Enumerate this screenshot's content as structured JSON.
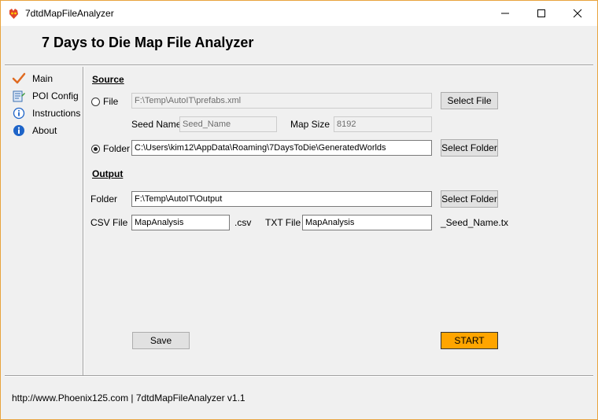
{
  "window": {
    "title": "7dtdMapFileAnalyzer",
    "header": "7 Days to Die Map File Analyzer"
  },
  "sidebar": {
    "items": [
      {
        "label": "Main",
        "icon": "checkmark-icon"
      },
      {
        "label": "POI Config",
        "icon": "config-icon"
      },
      {
        "label": "Instructions",
        "icon": "info-outline-icon"
      },
      {
        "label": "About",
        "icon": "info-icon"
      }
    ]
  },
  "source": {
    "heading": "Source",
    "file_option": "File",
    "file_path": "F:\\Temp\\AutoIT\\prefabs.xml",
    "select_file_label": "Select File",
    "seed_name_label": "Seed Name",
    "seed_name_placeholder": "Seed_Name",
    "map_size_label": "Map Size",
    "map_size_value": "8192",
    "folder_option": "Folder",
    "folder_path": "C:\\Users\\kim12\\AppData\\Roaming\\7DaysToDie\\GeneratedWorlds",
    "select_folder_label": "Select Folder"
  },
  "output": {
    "heading": "Output",
    "folder_label": "Folder",
    "folder_path": "F:\\Temp\\AutoIT\\Output",
    "select_folder_label": "Select Folder",
    "csv_label": "CSV File",
    "csv_value": "MapAnalysis",
    "csv_ext": ".csv",
    "txt_label": "TXT File",
    "txt_value": "MapAnalysis",
    "txt_suffix": "_Seed_Name.tx"
  },
  "actions": {
    "save_label": "Save",
    "start_label": "START"
  },
  "footer": {
    "text": "http://www.Phoenix125.com | 7dtdMapFileAnalyzer v1.1"
  },
  "colors": {
    "window_border": "#e8a33d",
    "start_button": "#ffa500",
    "check": "#e06a20",
    "info": "#1e64c8"
  }
}
